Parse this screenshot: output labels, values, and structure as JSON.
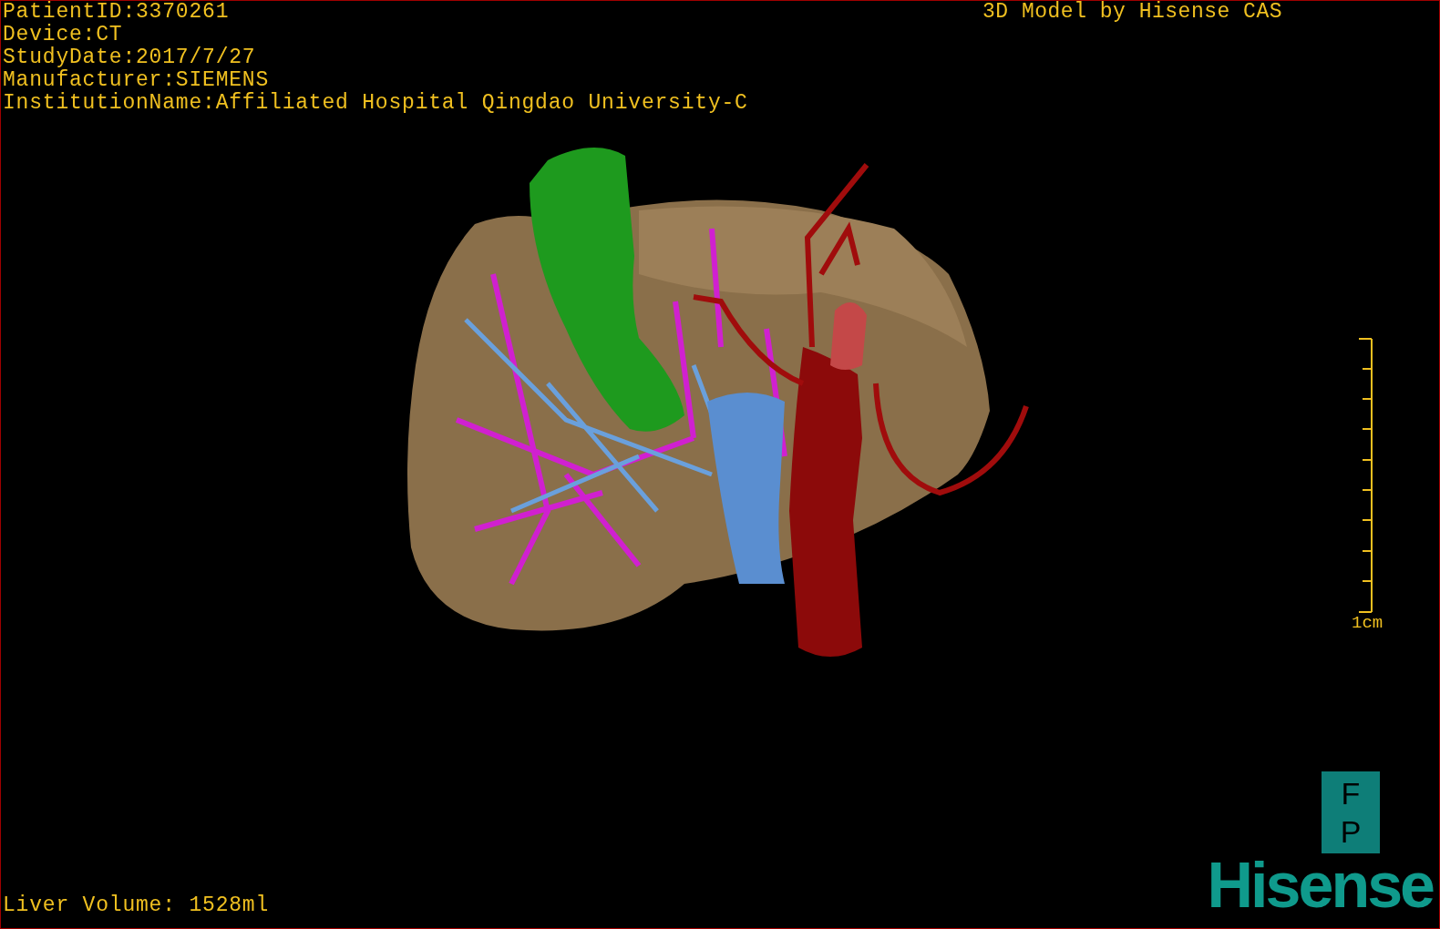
{
  "study_info": [
    "PatientID:3370261",
    "Device:CT",
    "StudyDate:2017/7/27",
    "Manufacturer:SIEMENS",
    "InstitutionName:Affiliated Hospital Qingdao University-C"
  ],
  "credit": "3D Model by Hisense CAS",
  "scale_bar": {
    "label": "1cm"
  },
  "volume": "Liver Volume: 1528ml",
  "orientation_cube": {
    "labels": [
      "F",
      "P"
    ]
  },
  "logo": "Hisense"
}
